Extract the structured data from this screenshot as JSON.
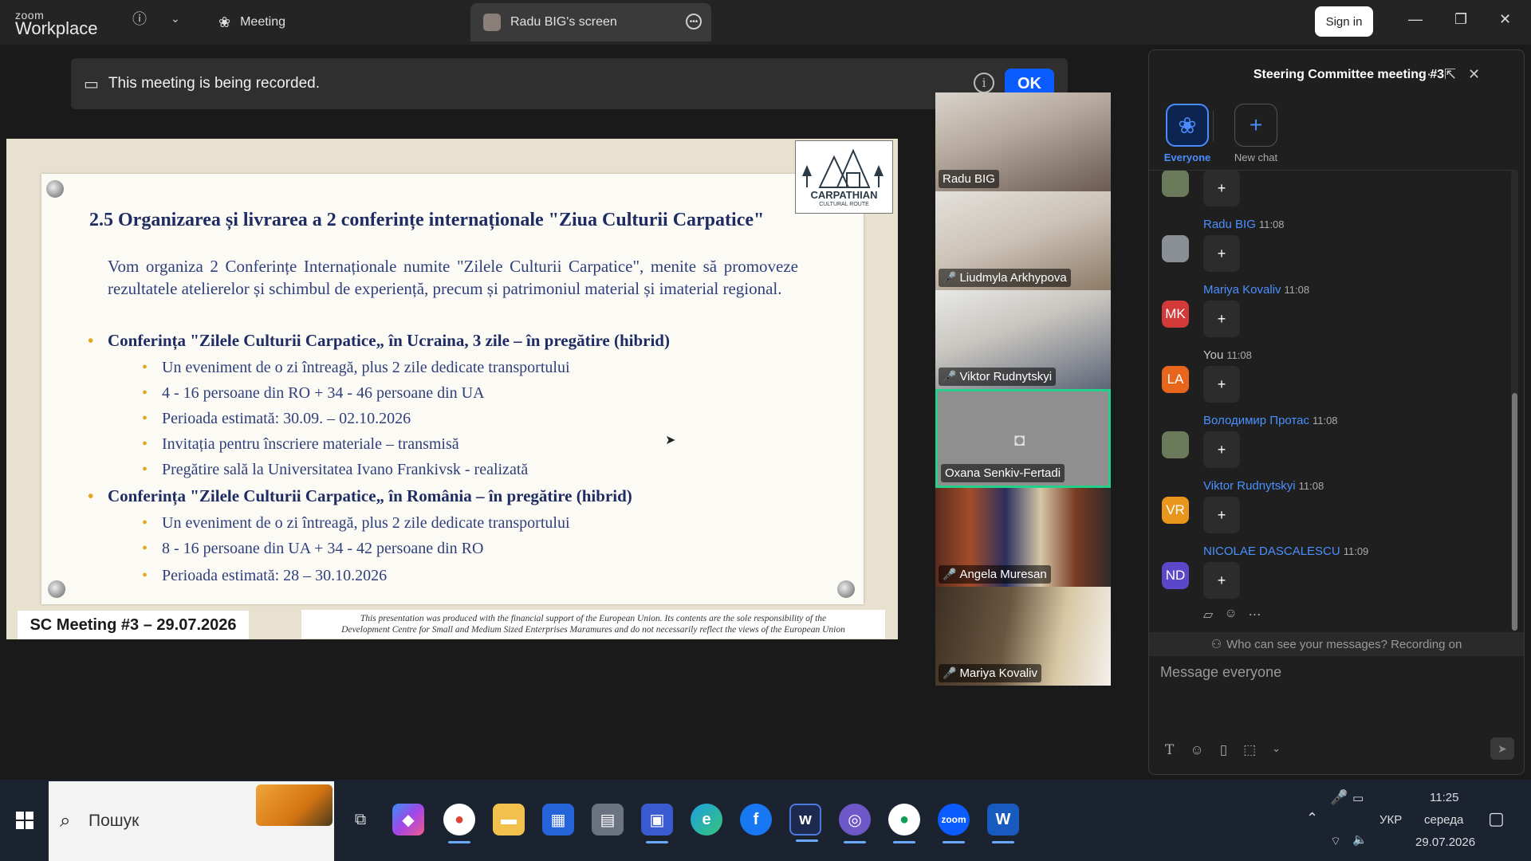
{
  "app": {
    "logo_line1": "zoom",
    "logo_line2": "Workplace",
    "tabs": [
      {
        "label": "Meeting"
      },
      {
        "label": "Radu BIG's screen"
      }
    ],
    "sign_in": "Sign in"
  },
  "banner": {
    "text": "This meeting is being recorded.",
    "ok": "OK"
  },
  "slide": {
    "title": "2.5 Organizarea și livrarea a 2 conferințe internaționale \"Ziua Culturii Carpatice\"",
    "intro": "Vom organiza 2 Conferințe Internaționale numite \"Zilele Culturii Carpatice\", menite să promoveze rezultatele atelierelor și schimbul de experiență, precum și patrimoniul material și imaterial regional.",
    "section1": {
      "heading": "Conferința \"Zilele Culturii Carpatice„ în Ucraina, 3 zile – în pregătire (hibrid)",
      "items": [
        "Un eveniment de o zi întreagă, plus 2 zile dedicate transportului",
        "4 - 16 persoane din RO + 34 - 46 persoane din UA",
        "Perioada estimată: 30.09. – 02.10.2026",
        "Invitația pentru înscriere materiale – transmisă",
        "Pregătire sală la Universitatea Ivano Frankivsk - realizată"
      ]
    },
    "section2": {
      "heading": "Conferința \"Zilele Culturii Carpatice„  în România – în pregătire (hibrid)",
      "items": [
        "Un eveniment de o zi întreagă, plus 2 zile dedicate transportului",
        "8 - 16 persoane din UA + 34 - 42 persoane din RO",
        "Perioada estimată: 28 – 30.10.2026"
      ]
    },
    "logo_line1": "CARPATHIAN",
    "logo_line2": "CULTURAL ROUTE",
    "footer_left": "SC Meeting #3 – 29.07.2026",
    "footer_right_1": "This presentation was produced with the financial support of the European Union. Its contents are the sole responsibility of the",
    "footer_right_2": "Development Centre for Small and Medium Sized Enterprises Maramures and do not necessarily reflect the views of the European Union"
  },
  "participants": [
    {
      "name": "Radu BIG",
      "muted": false
    },
    {
      "name": "Liudmyla Arkhypova",
      "muted": true
    },
    {
      "name": "Viktor Rudnytskyi",
      "muted": true
    },
    {
      "name": "Oxana Senkiv-Fertadi",
      "muted": false
    },
    {
      "name": "Angela Muresan",
      "muted": true
    },
    {
      "name": "Mariya Kovaliv",
      "muted": true
    }
  ],
  "chat": {
    "title": "Steering Committee meeting #3",
    "channels": [
      {
        "label": "Everyone",
        "icon": "+"
      },
      {
        "label": "New chat",
        "icon": "+"
      }
    ],
    "messages": [
      {
        "sender": "",
        "time": "",
        "initials": "",
        "avatar_color": "#6b7a5a",
        "reaction": "+"
      },
      {
        "sender": "Radu BIG",
        "time": "11:08",
        "initials": "",
        "avatar_color": "#8a8f96",
        "reaction": "+"
      },
      {
        "sender": "Mariya Kovaliv",
        "time": "11:08",
        "initials": "MK",
        "avatar_color": "#d23a3a",
        "reaction": "+"
      },
      {
        "sender": "You",
        "time": "11:08",
        "initials": "LA",
        "avatar_color": "#e8651c",
        "reaction": "+"
      },
      {
        "sender": "Володимир Протас",
        "time": "11:08",
        "initials": "",
        "avatar_color": "#6b7a5a",
        "reaction": "+"
      },
      {
        "sender": "Viktor Rudnytskyi",
        "time": "11:08",
        "initials": "VR",
        "avatar_color": "#e8961c",
        "reaction": "+"
      },
      {
        "sender": "NICOLAE DASCALESCU",
        "time": "11:09",
        "initials": "ND",
        "avatar_color": "#5b47c9",
        "reaction": "+"
      }
    ],
    "privacy": "Who can see your messages? Recording on",
    "compose_placeholder": "Message everyone"
  },
  "taskbar": {
    "search_placeholder": "Пошук",
    "lang": "УКР",
    "time": "11:25",
    "weekday": "середа",
    "date": "29.07.2026"
  }
}
